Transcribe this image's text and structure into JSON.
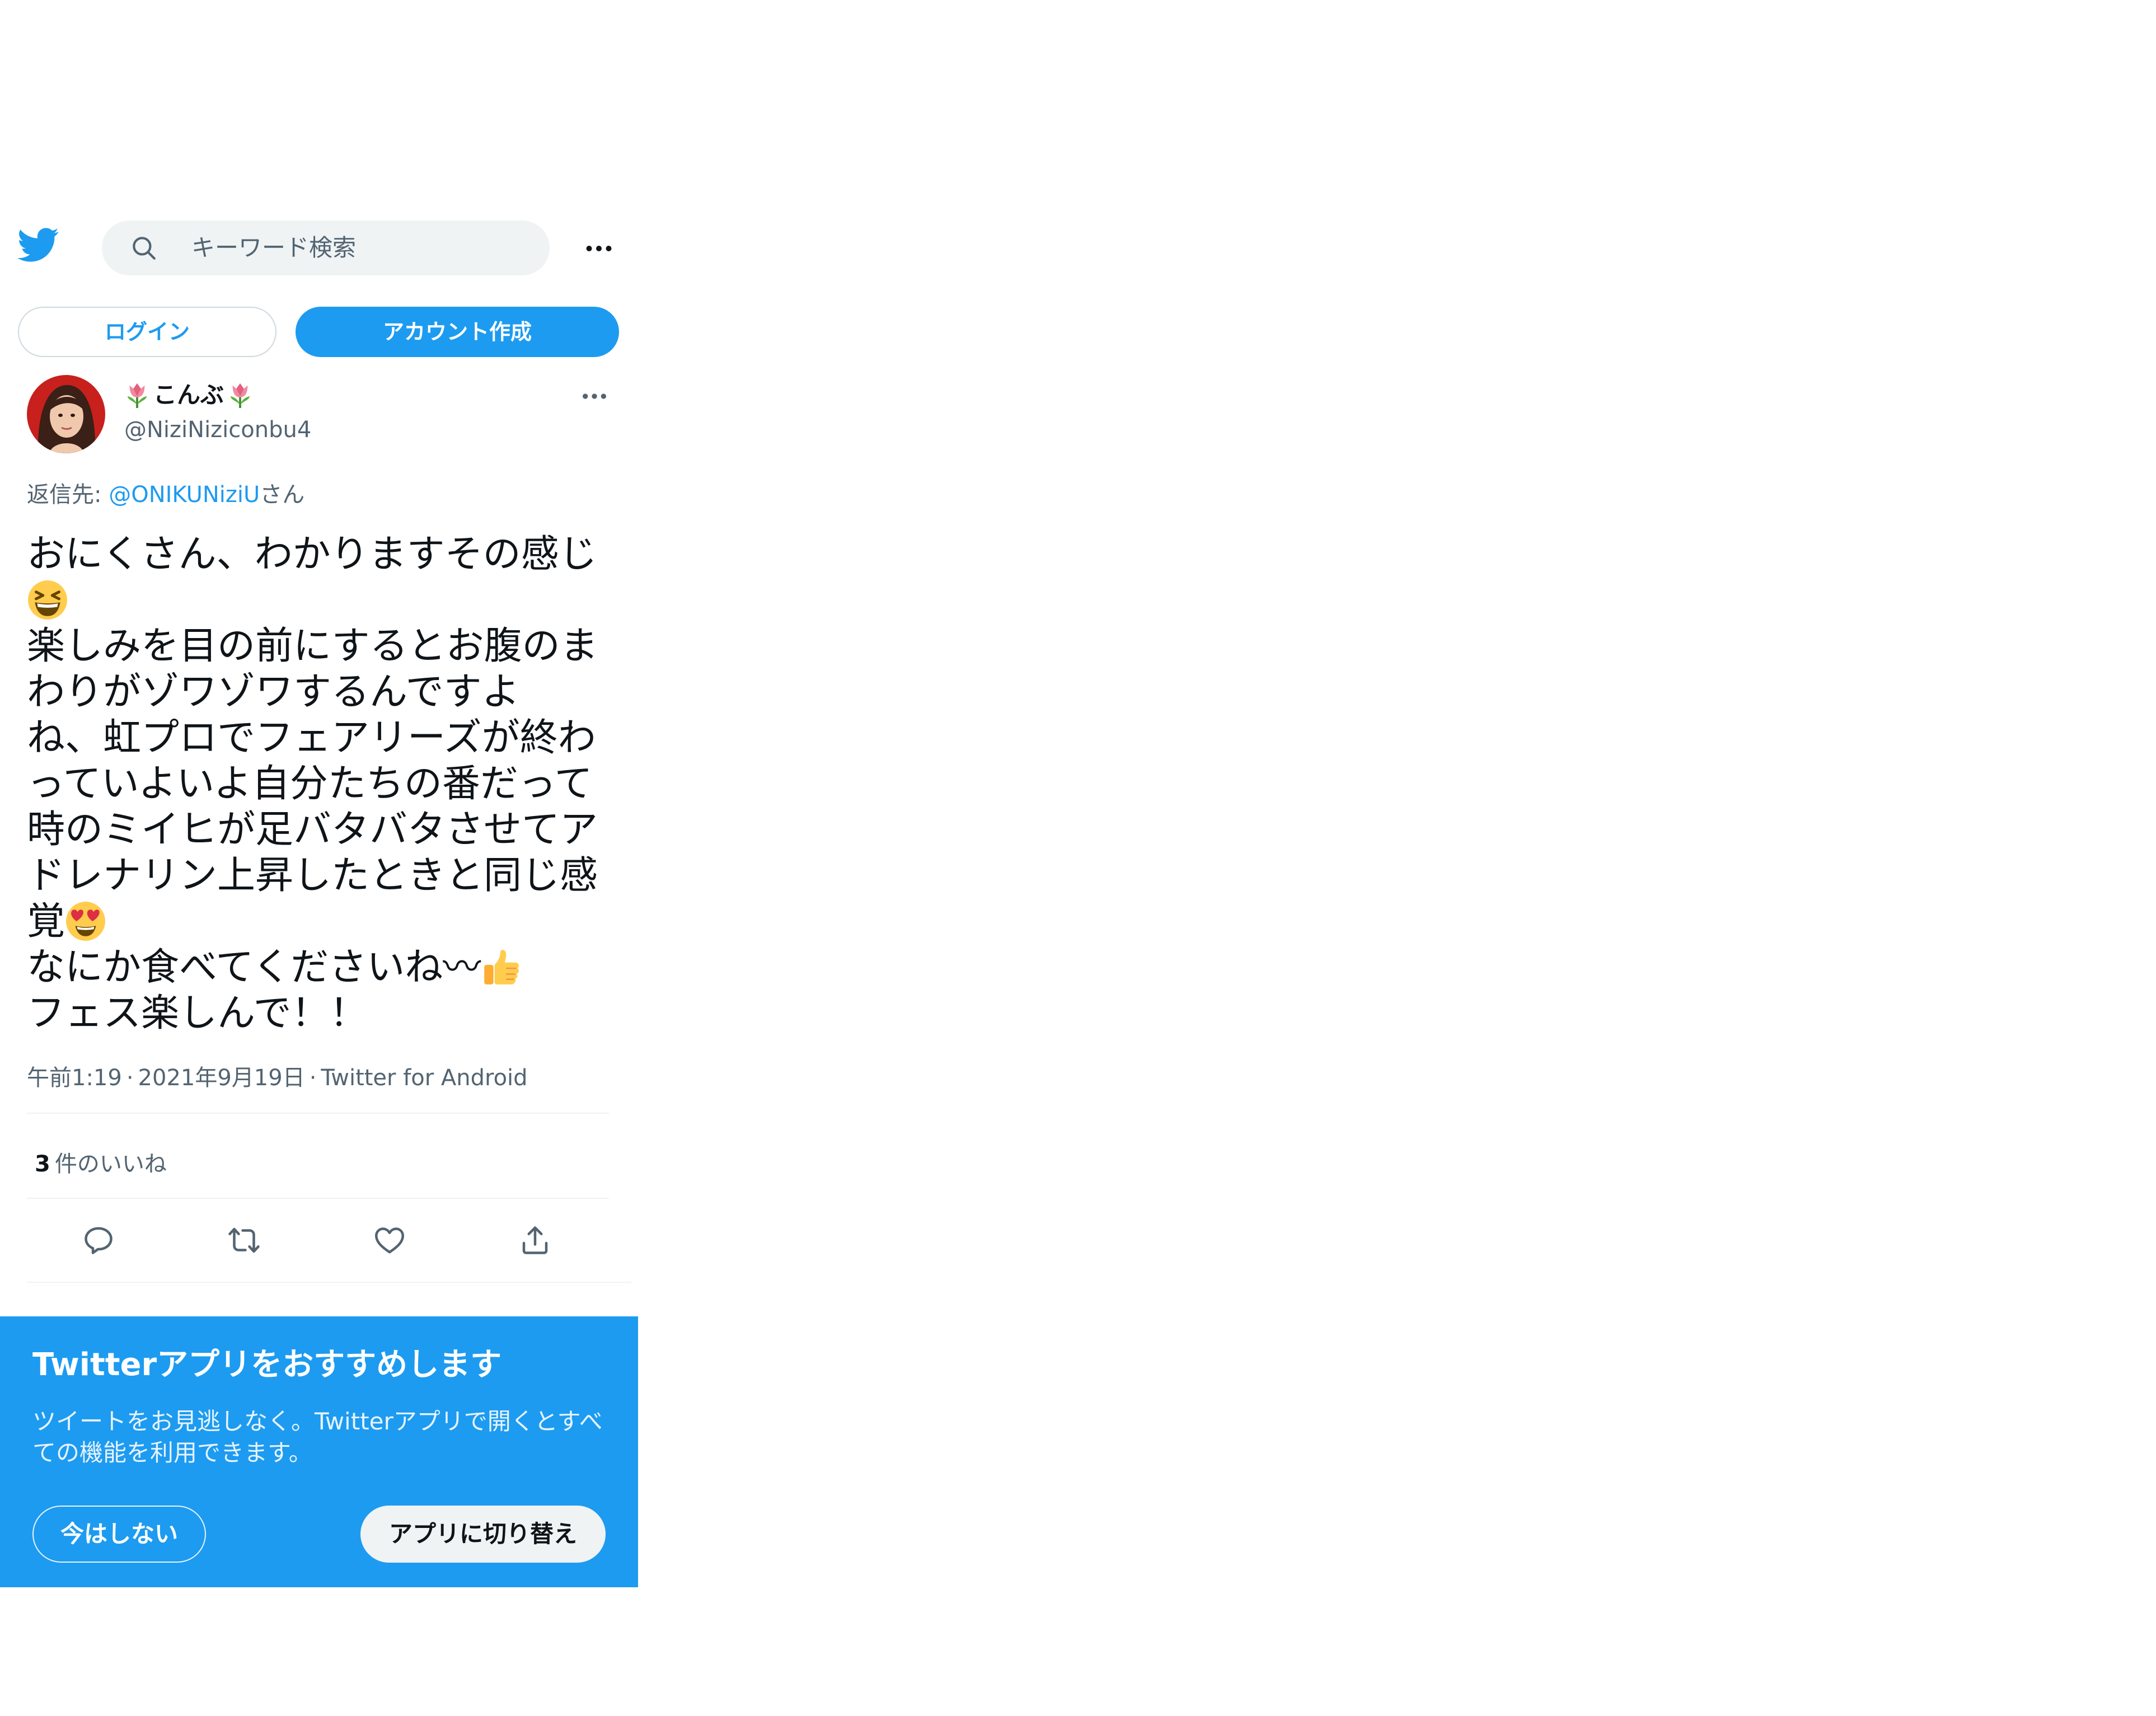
{
  "header": {
    "search_placeholder": "キーワード検索",
    "login_label": "ログイン",
    "signup_label": "アカウント作成"
  },
  "tweet": {
    "display_name": "こんぶ",
    "handle": "@NiziNiziconbu4",
    "reply_prefix": "返信先: ",
    "reply_to": "@ONIKUNiziU",
    "reply_suffix": "さん",
    "lines": {
      "l1": "おにくさん、わかりますその感じ",
      "l3": "楽しみを目の前にするとお腹のま",
      "l4": "わりがゾワゾワするんですよ",
      "l5": "ね、虹プロでフェアリーズが終わ",
      "l6": "っていよいよ自分たちの番だって",
      "l7": "時のミイヒが足バタバタさせてア",
      "l8": "ドレナリン上昇したときと同じ感",
      "l9": "覚",
      "l10": "なにか食べてくださいね〰",
      "l11": "フェス楽しんで！！"
    },
    "time": "午前1:19",
    "date": "2021年9月19日",
    "source": "Twitter for Android",
    "likes_count": "3",
    "likes_label": "件のいいね"
  },
  "banner": {
    "title": "Twitterアプリをおすすめします",
    "description": "ツイートをお見逃しなく。Twitterアプリで開くとすべての機能を利用できます。",
    "later_label": "今はしない",
    "switch_label": "アプリに切り替え"
  },
  "colors": {
    "accent": "#1d9bf0",
    "text": "#0f1419",
    "secondary": "#536471"
  },
  "icons": [
    "twitter-bird-icon",
    "search-icon",
    "more-icon",
    "tulip-emoji",
    "grinning-squinting-emoji",
    "heart-eyes-emoji",
    "thumbs-up-emoji",
    "reply-icon",
    "retweet-icon",
    "like-icon",
    "share-icon"
  ]
}
